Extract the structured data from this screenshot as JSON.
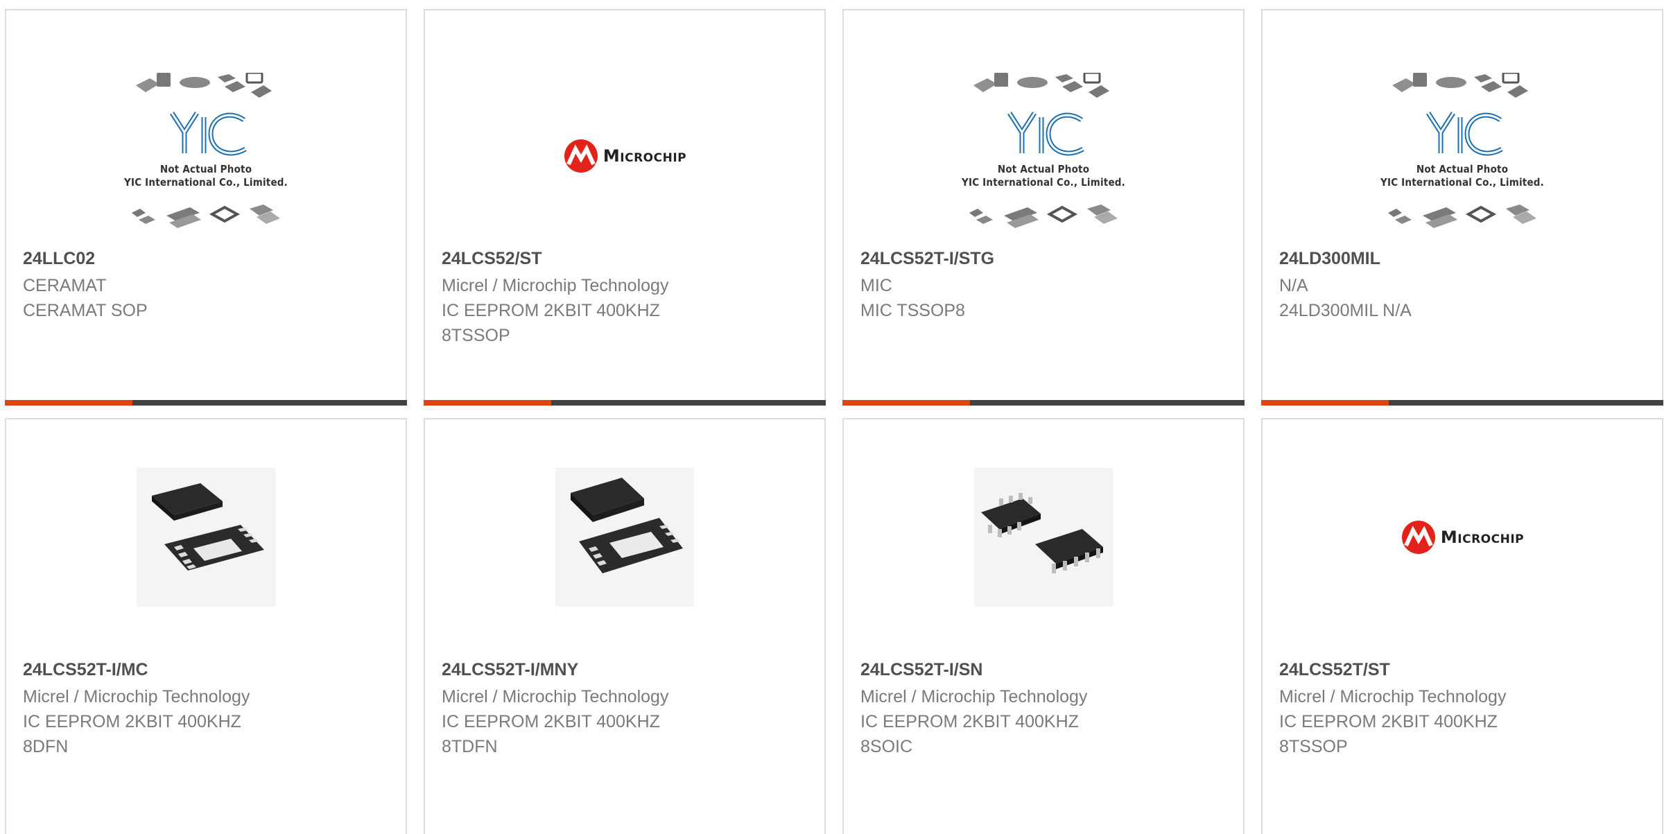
{
  "placeholder": {
    "line1": "Not Actual Photo",
    "line2": "YIC International Co., Limited.",
    "logo_text": "YIC"
  },
  "brand_logo_text": "Microchip",
  "colors": {
    "accent": "#e2420d",
    "bar_dark": "#3f4144",
    "border": "#dcdcdc",
    "text": "#7a7a7a",
    "title": "#505050"
  },
  "products": [
    {
      "part": "24LLC02",
      "lines": [
        "CERAMAT",
        "CERAMAT SOP"
      ],
      "image": "placeholder"
    },
    {
      "part": "24LCS52/ST",
      "lines": [
        "Micrel / Microchip Technology",
        "IC EEPROM 2KBIT 400KHZ",
        "8TSSOP"
      ],
      "image": "microchip-logo"
    },
    {
      "part": "24LCS52T-I/STG",
      "lines": [
        "MIC",
        "MIC TSSOP8"
      ],
      "image": "placeholder"
    },
    {
      "part": "24LD300MIL",
      "lines": [
        "N/A",
        "24LD300MIL N/A"
      ],
      "image": "placeholder"
    },
    {
      "part": "24LCS52T-I/MC",
      "lines": [
        "Micrel / Microchip Technology",
        "IC EEPROM 2KBIT 400KHZ",
        "8DFN"
      ],
      "image": "dfn-photo"
    },
    {
      "part": "24LCS52T-I/MNY",
      "lines": [
        "Micrel / Microchip Technology",
        "IC EEPROM 2KBIT 400KHZ",
        "8TDFN"
      ],
      "image": "tdfn-photo"
    },
    {
      "part": "24LCS52T-I/SN",
      "lines": [
        "Micrel / Microchip Technology",
        "IC EEPROM 2KBIT 400KHZ",
        "8SOIC"
      ],
      "image": "soic-photo"
    },
    {
      "part": "24LCS52T/ST",
      "lines": [
        "Micrel / Microchip Technology",
        "IC EEPROM 2KBIT 400KHZ",
        "8TSSOP"
      ],
      "image": "microchip-logo"
    }
  ]
}
